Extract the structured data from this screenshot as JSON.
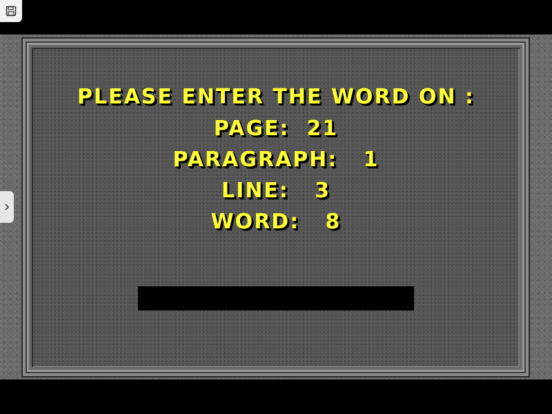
{
  "toolbar": {
    "save_icon": "floppy-disk-icon",
    "side_tab_icon": "chevron-right-icon"
  },
  "copy_protection": {
    "heading": "PLEASE ENTER THE WORD ON :",
    "page_line": "PAGE:  21",
    "paragraph_line": "PARAGRAPH:   1",
    "line_line": "LINE:   3",
    "word_line": "WORD:   8",
    "answer_value": ""
  },
  "colors": {
    "text": "#ffff33",
    "text_shadow": "#000000",
    "panel": "#555555",
    "input": "#000000"
  }
}
